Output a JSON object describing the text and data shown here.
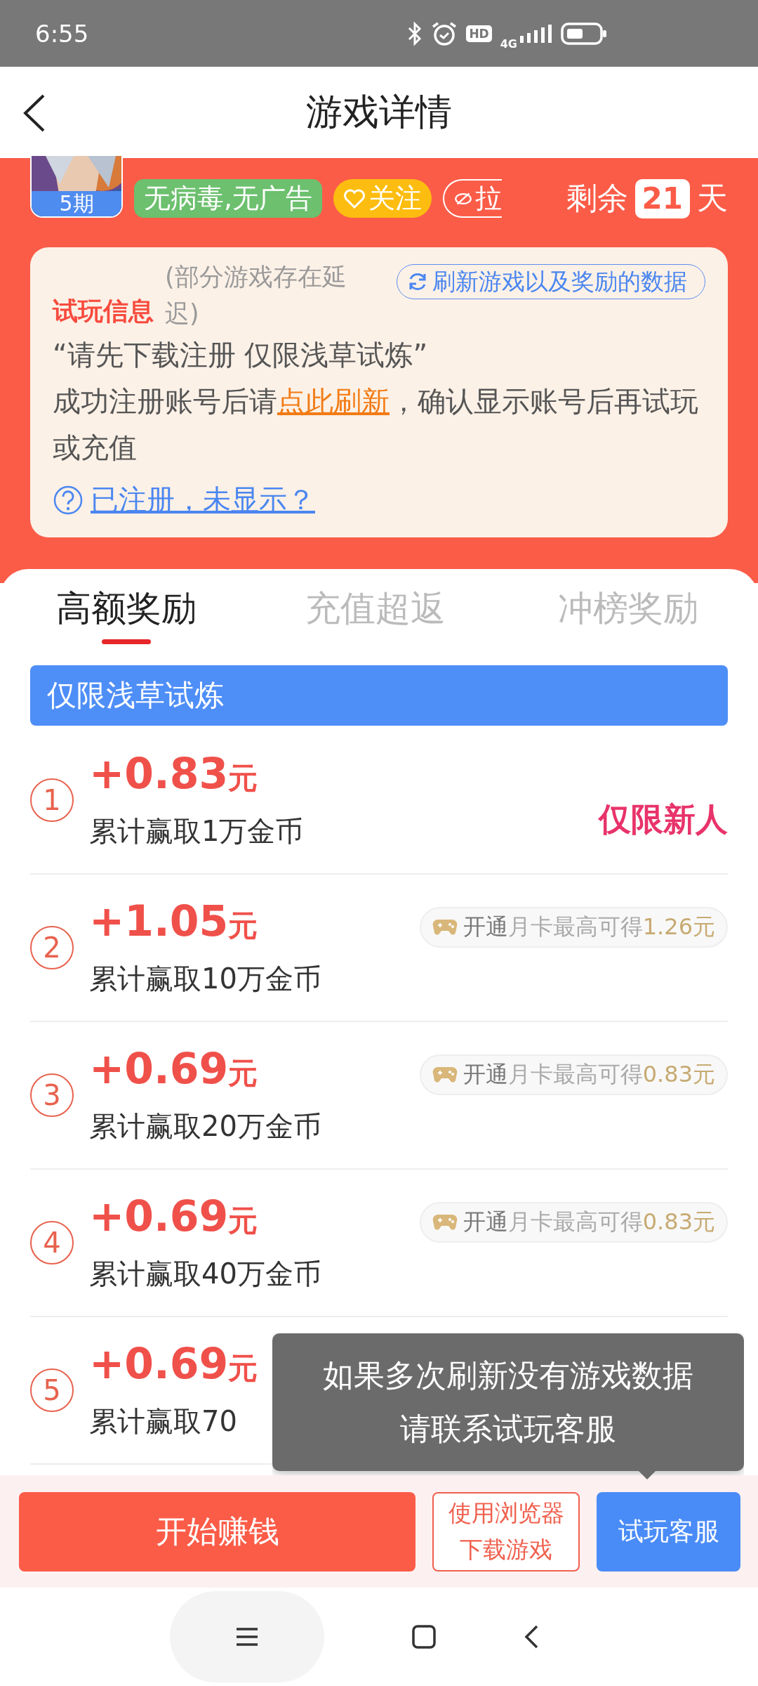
{
  "status_bar": {
    "time": "6:55",
    "hd": "HD",
    "network": "4G"
  },
  "header": {
    "title": "游戏详情"
  },
  "game": {
    "period_badge": "5期",
    "tags": [
      {
        "label": "无病毒,无广告",
        "kind": "safe"
      },
      {
        "label": "关注",
        "kind": "follow"
      },
      {
        "label": "拉",
        "kind": "hidden"
      }
    ],
    "remaining": {
      "prefix": "剩余",
      "days": "21",
      "suffix": "天"
    }
  },
  "trial_info": {
    "title": "试玩信息",
    "note": "(部分游戏存在延迟)",
    "refresh_button": "刷新游戏以及奖励的数据",
    "quote": "“请先下载注册 仅限浅草试炼”",
    "instruction": {
      "before": "成功注册账号后请",
      "link": "点此刷新",
      "after": "，确认显示账号后再试玩或充值"
    },
    "help_link": "已注册，未显示？"
  },
  "tabs": [
    {
      "label": "高额奖励",
      "selected": true
    },
    {
      "label": "充值超返",
      "selected": false
    },
    {
      "label": "冲榜奖励",
      "selected": false
    }
  ],
  "banner": "仅限浅草试炼",
  "rewards": [
    {
      "index": "1",
      "amount": "+0.83",
      "unit": "元",
      "goal": "累计赢取1万金币",
      "kind": "new",
      "badge": "仅限新人"
    },
    {
      "index": "2",
      "amount": "+1.05",
      "unit": "元",
      "goal": "累计赢取10万金币",
      "kind": "card",
      "badge_prefix": "开通",
      "badge": "月卡最高可得",
      "badge_value": "1.26元"
    },
    {
      "index": "3",
      "amount": "+0.69",
      "unit": "元",
      "goal": "累计赢取20万金币",
      "kind": "card",
      "badge_prefix": "开通",
      "badge": "月卡最高可得",
      "badge_value": "0.83元"
    },
    {
      "index": "4",
      "amount": "+0.69",
      "unit": "元",
      "goal": "累计赢取40万金币",
      "kind": "card",
      "badge_prefix": "开通",
      "badge": "月卡最高可得",
      "badge_value": "0.83元"
    },
    {
      "index": "5",
      "amount": "+0.69",
      "unit": "元",
      "goal": "累计赢取70",
      "kind": "plain"
    }
  ],
  "tooltip": {
    "lines": [
      "如果多次刷新没有游戏数据",
      "请联系试玩客服"
    ]
  },
  "actions": {
    "start_button": "开始赚钱",
    "browser_button": "使用浏览器下载游戏",
    "service_button": "试玩客服"
  }
}
